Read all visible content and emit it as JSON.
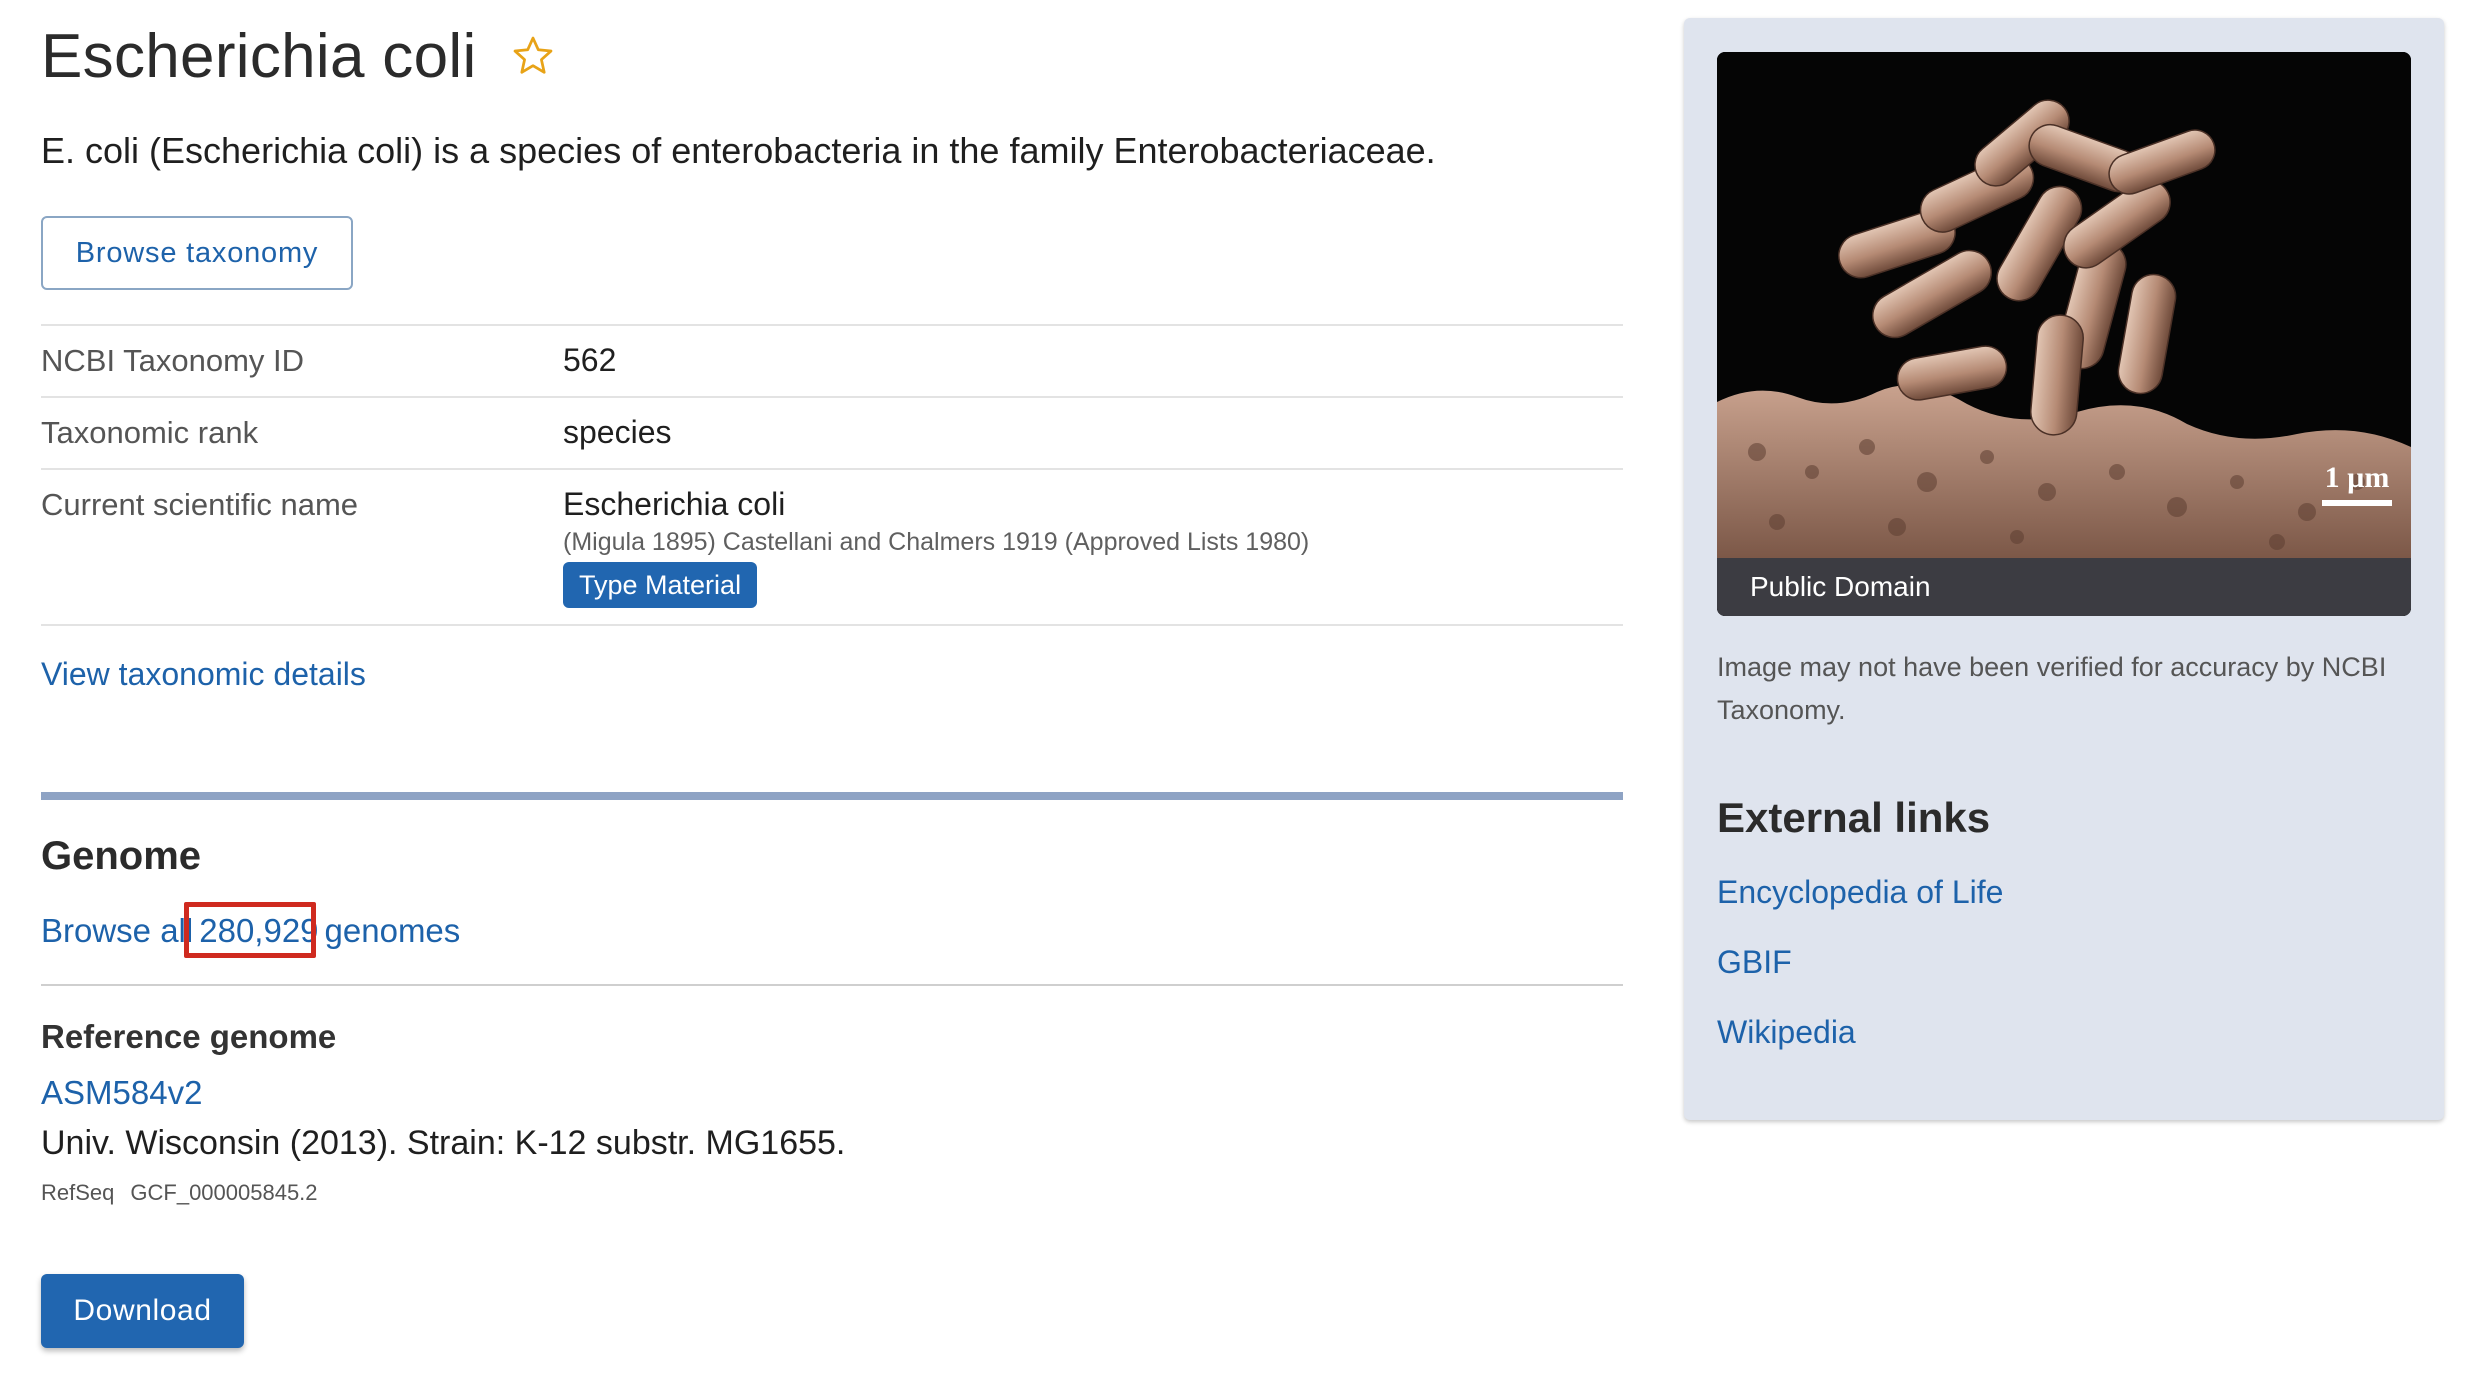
{
  "header": {
    "title": "Escherichia coli",
    "favorite_icon": "star-outline-icon",
    "favorite_color": "#e8a317",
    "description": "E. coli (Escherichia coli) is a species of enterobacteria in the family Enterobacteriaceae."
  },
  "actions": {
    "browse_taxonomy_label": "Browse taxonomy",
    "view_details_label": "View taxonomic details",
    "download_label": "Download"
  },
  "taxonomy": {
    "rows": [
      {
        "label": "NCBI Taxonomy ID",
        "value": "562"
      },
      {
        "label": "Taxonomic rank",
        "value": "species"
      },
      {
        "label": "Current scientific name",
        "value": "Escherichia coli",
        "authority": "(Migula 1895) Castellani and Chalmers 1919 (Approved Lists 1980)",
        "badge": "Type Material"
      }
    ]
  },
  "genome": {
    "heading": "Genome",
    "browse_prefix": "Browse all",
    "count": "280,929",
    "browse_suffix": "genomes",
    "reference_heading": "Reference genome",
    "assembly_name": "ASM584v2",
    "assembly_description": "Univ. Wisconsin (2013). Strain: K-12 substr. MG1655.",
    "accession_db": "RefSeq",
    "accession": "GCF_000005845.2"
  },
  "sidebar": {
    "image_caption": "Public Domain",
    "image_scale_label": "1 µm",
    "disclaimer": "Image may not have been verified for accuracy by NCBI Taxonomy.",
    "external_heading": "External links",
    "external_links": [
      {
        "label": "Encyclopedia of Life"
      },
      {
        "label": "GBIF"
      },
      {
        "label": "Wikipedia"
      }
    ]
  },
  "colors": {
    "link": "#1d62aa",
    "primary_button": "#2166b0",
    "highlight_box": "#cf2a1f",
    "section_bar": "#8ea3c4",
    "sidebar_bg": "#dfe4ee"
  }
}
